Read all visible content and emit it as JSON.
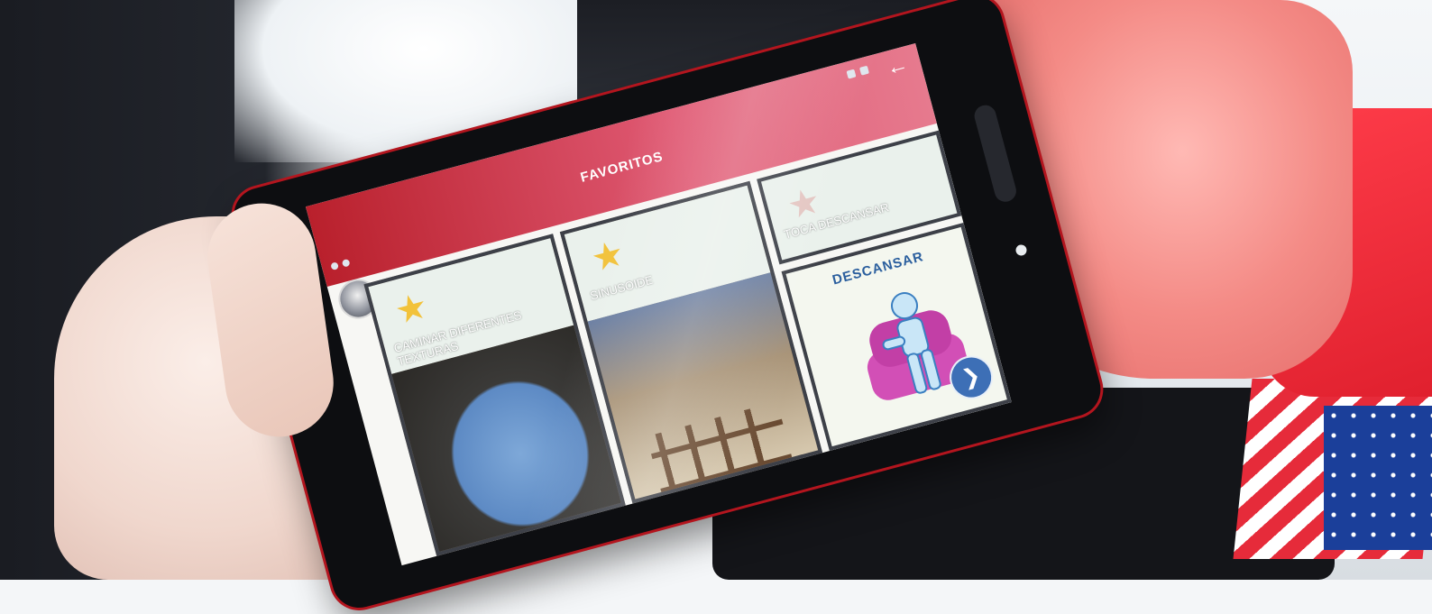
{
  "app": {
    "header_title": "FAVORITOS"
  },
  "cards": [
    {
      "label": "CAMINAR DIFERENTES TEXTURAS",
      "icon": "star-icon"
    },
    {
      "label": "SINUSOIDE",
      "icon": "star-icon"
    },
    {
      "label": "TOCA DESCANSAR",
      "icon": "star-icon"
    }
  ],
  "pictogram_card": {
    "title": "DESCANSAR",
    "icon": "person-in-armchair-icon"
  },
  "colors": {
    "header": "#d9435c",
    "tablet_frame": "#b3151e",
    "star": "#f2c23a",
    "pictogram_title": "#2b5f9e",
    "next_button": "#3d6fb6"
  }
}
